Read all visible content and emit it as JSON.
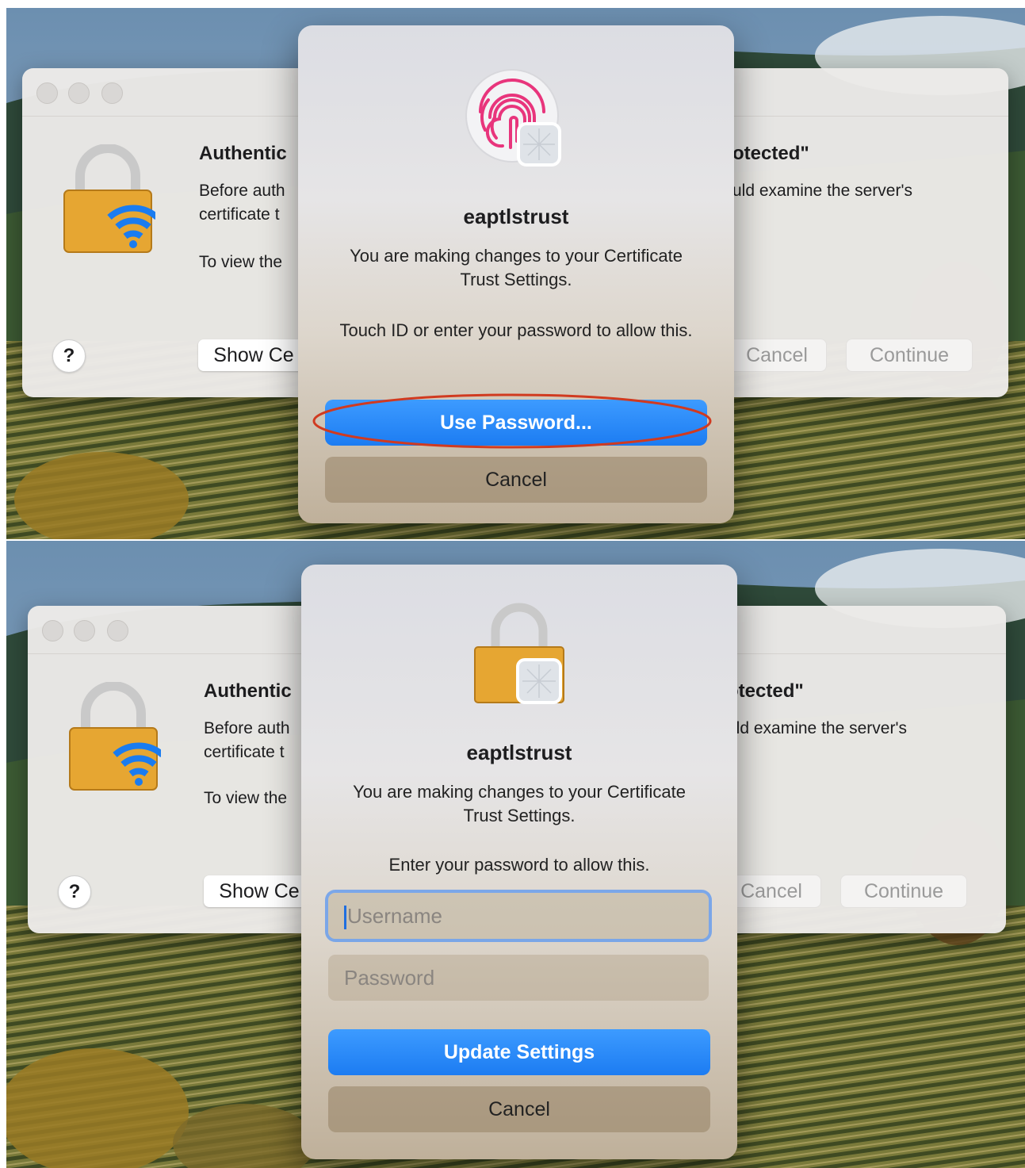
{
  "colors": {
    "accent": "#1c7cf2",
    "highlight_ellipse": "#d03a20",
    "touchid_pink": "#e8357c"
  },
  "panels": [
    {
      "window": {
        "title_partial": "Authentic",
        "title_right_partial": "otected\"",
        "text_line1": "Before auth",
        "text_line2": "certificate t",
        "text_right": "uld examine the server's",
        "text_line3": "To view the",
        "help": "?",
        "show_button": "Show Ce",
        "cancel_button": "Cancel",
        "continue_button": "Continue"
      },
      "dialog": {
        "icon": "touchid-icon",
        "title": "eaptlstrust",
        "message": "You are making changes to your Certificate Trust Settings.",
        "prompt": "Touch ID or enter your password to allow this.",
        "primary_button": "Use Password...",
        "secondary_button": "Cancel"
      }
    },
    {
      "window": {
        "title_partial": "Authentic",
        "title_right_partial": "otected\"",
        "text_line1": "Before auth",
        "text_line2": "certificate t",
        "text_right": "uld examine the server's",
        "text_line3": "To view the",
        "help": "?",
        "show_button": "Show Ce",
        "cancel_button": "Cancel",
        "continue_button": "Continue"
      },
      "dialog": {
        "icon": "lock-icon",
        "title": "eaptlstrust",
        "message": "You are making changes to your Certificate Trust Settings.",
        "prompt": "Enter your password to allow this.",
        "username_placeholder": "Username",
        "password_placeholder": "Password",
        "primary_button": "Update Settings",
        "secondary_button": "Cancel"
      }
    }
  ]
}
